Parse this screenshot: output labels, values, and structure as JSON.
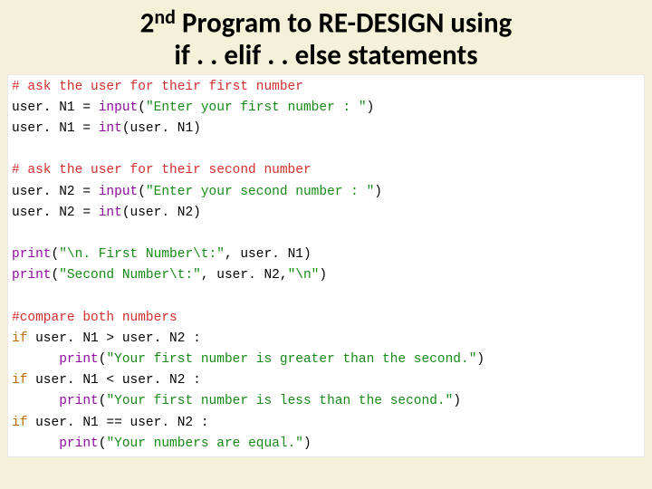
{
  "title": {
    "pre": "2",
    "sup": "nd",
    "rest1": " Program to RE-DESIGN using",
    "line2": "if . . elif . . else statements"
  },
  "code": {
    "l1_comment": "# ask the user for their first number",
    "l2_a": "user. N1 = ",
    "l2_b": "input",
    "l2_c": "(",
    "l2_d": "\"Enter your first number : \"",
    "l2_e": ")",
    "l3_a": "user. N1 = ",
    "l3_b": "int",
    "l3_c": "(user. N1)",
    "l4_comment": "# ask the user for their second number",
    "l5_a": "user. N2 = ",
    "l5_b": "input",
    "l5_c": "(",
    "l5_d": "\"Enter your second number : \"",
    "l5_e": ")",
    "l6_a": "user. N2 = ",
    "l6_b": "int",
    "l6_c": "(user. N2)",
    "l7_a": "print",
    "l7_b": "(",
    "l7_c": "\"\\n. First Number\\t:\"",
    "l7_d": ", user. N1)",
    "l8_a": "print",
    "l8_b": "(",
    "l8_c": "\"Second Number\\t:\"",
    "l8_d": ", user. N2,",
    "l8_e": "\"\\n\"",
    "l8_f": ")",
    "l9_comment": "#compare both numbers",
    "l10_a": "if",
    "l10_b": " user. N1 > user. N2 :",
    "l11_a": "print",
    "l11_b": "(",
    "l11_c": "\"Your first number is greater than the second.\"",
    "l11_d": ")",
    "l12_a": "if",
    "l12_b": " user. N1 < user. N2 :",
    "l13_a": "print",
    "l13_b": "(",
    "l13_c": "\"Your first number is less than the second.\"",
    "l13_d": ")",
    "l14_a": "if",
    "l14_b": " user. N1 == user. N2 :",
    "l15_a": "print",
    "l15_b": "(",
    "l15_c": "\"Your numbers are equal.\"",
    "l15_d": ")"
  }
}
